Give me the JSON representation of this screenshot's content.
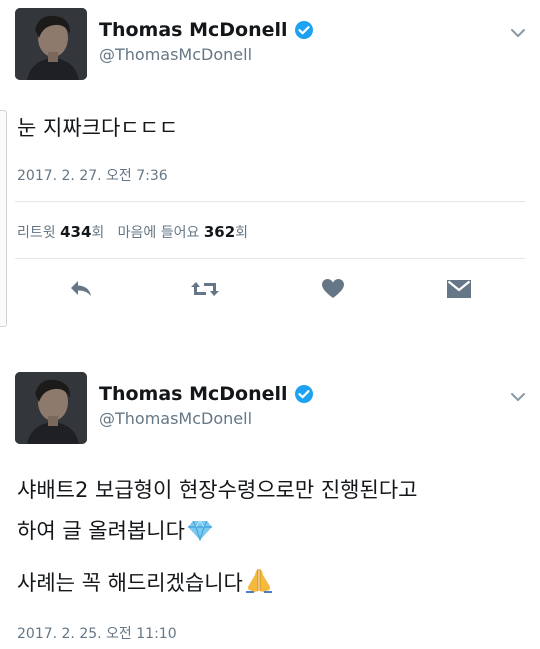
{
  "tweets": [
    {
      "display_name": "Thomas McDonell",
      "handle": "@ThomasMcDonell",
      "text": "눈 지짜크다ㄷㄷㄷ",
      "timestamp": "2017. 2. 27. 오전 7:36",
      "stats": {
        "retweet_label": "리트윗",
        "retweet_count": "434",
        "retweet_suffix": "회",
        "like_label": "마음에 들어요",
        "like_count": "362",
        "like_suffix": "회"
      },
      "actions": [
        "reply-icon",
        "retweet-icon",
        "heart-icon",
        "direct-message-icon"
      ]
    },
    {
      "display_name": "Thomas McDonell",
      "handle": "@ThomasMcDonell",
      "text_line1": "샤배트2 보급형이 현장수령으로만 진행된다고",
      "text_line2": "하여 글 올려봅니다",
      "text_line3": "사례는 꼭 해드리겠습니다",
      "emoji_line2": "gem-icon",
      "emoji_line3": "folded-hands-icon",
      "timestamp": "2017. 2. 25. 오전 11:10"
    }
  ],
  "colors": {
    "verified": "#1da1f2",
    "action_icon": "#657786",
    "secondary_text": "#657786",
    "divider": "#e1e8ed"
  }
}
